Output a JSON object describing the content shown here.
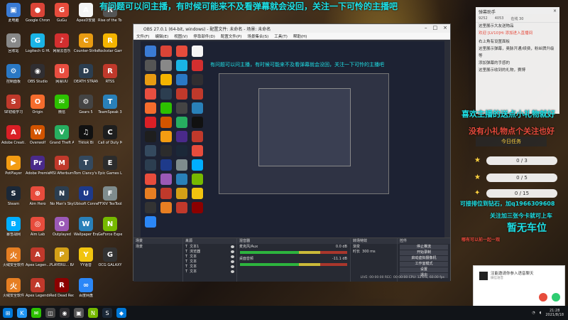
{
  "banner": {
    "text": "有问题可以问主播，有时候可能来不及看弹幕就会没回，关注一下可怜的主播吧"
  },
  "desktop_icons": [
    {
      "label": "此电脑",
      "color": "#3a7bd5",
      "glyph": "▣",
      "icon": "computer-icon"
    },
    {
      "label": "Google Chrome",
      "color": "#db4437",
      "glyph": "●",
      "icon": "chrome-icon"
    },
    {
      "label": "GuGu",
      "color": "#e74c3c",
      "glyph": "G",
      "icon": "app-icon"
    },
    {
      "label": "ApexD安装",
      "color": "#f5f5f5",
      "glyph": "A",
      "icon": "file-icon"
    },
    {
      "label": "Rise of the Tomb Ra...",
      "color": "#555",
      "glyph": "R",
      "icon": "game-icon"
    },
    {
      "label": "回收站",
      "color": "#888",
      "glyph": "♻",
      "icon": "recycle-bin-icon"
    },
    {
      "label": "Logitech G HUB",
      "color": "#1ab4e6",
      "glyph": "G",
      "icon": "logitech-icon"
    },
    {
      "label": "网易云音乐",
      "color": "#d32f2f",
      "glyph": "♪",
      "icon": "music-icon"
    },
    {
      "label": "Counter-Strike Global Off...",
      "color": "#e89b12",
      "glyph": "C",
      "icon": "csgo-icon"
    },
    {
      "label": "Rockstar Games",
      "color": "#f4b400",
      "glyph": "R",
      "icon": "rockstar-icon"
    },
    {
      "label": "控制面板",
      "color": "#2a78c4",
      "glyph": "⚙",
      "icon": "control-panel-icon"
    },
    {
      "label": "OBS Studio",
      "color": "#302e31",
      "glyph": "◉",
      "icon": "obs-icon"
    },
    {
      "label": "网易UU",
      "color": "#e84e40",
      "glyph": "U",
      "icon": "uu-icon"
    },
    {
      "label": "DEATH STRANDING",
      "color": "#2c3e50",
      "glyph": "D",
      "icon": "game-icon"
    },
    {
      "label": "RTSS",
      "color": "#c0392b",
      "glyph": "R",
      "icon": "rtss-icon"
    },
    {
      "label": "SE初级学习",
      "color": "#c0392b",
      "glyph": "S",
      "icon": "app-icon"
    },
    {
      "label": "Origin",
      "color": "#f56c2d",
      "glyph": "O",
      "icon": "origin-icon"
    },
    {
      "label": "微信",
      "color": "#2dc100",
      "glyph": "✉",
      "icon": "wechat-icon"
    },
    {
      "label": "Gears 5",
      "color": "#444",
      "glyph": "⚙",
      "icon": "game-icon"
    },
    {
      "label": "TeamSpeak 3",
      "color": "#2980b9",
      "glyph": "T",
      "icon": "teamspeak-icon"
    },
    {
      "label": "Adobe Creati...",
      "color": "#da1f26",
      "glyph": "A",
      "icon": "adobe-icon"
    },
    {
      "label": "Overwolf",
      "color": "#d35400",
      "glyph": "W",
      "icon": "overwolf-icon"
    },
    {
      "label": "Grand Theft Auto V",
      "color": "#27ae60",
      "glyph": "V",
      "icon": "gta-icon"
    },
    {
      "label": "Tiktok Bi",
      "color": "#111",
      "glyph": "♫",
      "icon": "app-icon"
    },
    {
      "label": "Call of Duty Modern...",
      "color": "#1e1e1e",
      "glyph": "C",
      "icon": "game-icon"
    },
    {
      "label": "PotPlayer",
      "color": "#f39c12",
      "glyph": "▶",
      "icon": "potplayer-icon"
    },
    {
      "label": "Adobe Premie...",
      "color": "#4a2a8a",
      "glyph": "Pr",
      "icon": "premiere-icon"
    },
    {
      "label": "MSI Afterburner",
      "color": "#c0392b",
      "glyph": "M",
      "icon": "msi-icon"
    },
    {
      "label": "Tom Clancy's R...",
      "color": "#34495e",
      "glyph": "T",
      "icon": "game-icon"
    },
    {
      "label": "Epic Games Launcher",
      "color": "#2c2c2c",
      "glyph": "E",
      "icon": "epic-icon"
    },
    {
      "label": "Steam",
      "color": "#1b2838",
      "glyph": "S",
      "icon": "steam-icon"
    },
    {
      "label": "Aim Hero",
      "color": "#e74c3c",
      "glyph": "⊕",
      "icon": "aim-icon"
    },
    {
      "label": "No Man's Sky",
      "color": "#2c3e50",
      "glyph": "N",
      "icon": "game-icon"
    },
    {
      "label": "Ubisoft Connect",
      "color": "#1e3a8a",
      "glyph": "U",
      "icon": "ubisoft-icon"
    },
    {
      "label": "FFXIV TexTools",
      "color": "#7f8c8d",
      "glyph": "F",
      "icon": "app-icon"
    },
    {
      "label": "暴雪战网",
      "color": "#00aeff",
      "glyph": "B",
      "icon": "battlenet-icon"
    },
    {
      "label": "Aim Lab",
      "color": "#e74c3c",
      "glyph": "◎",
      "icon": "aimlab-icon"
    },
    {
      "label": "Outplayed",
      "color": "#9b59b6",
      "glyph": "O",
      "icon": "outplayed-icon"
    },
    {
      "label": "Wallpaper Engine",
      "color": "#2980b9",
      "glyph": "W",
      "icon": "wallpaper-icon"
    },
    {
      "label": "GeForce Experience",
      "color": "#76b900",
      "glyph": "N",
      "icon": "nvidia-icon"
    },
    {
      "label": "火绒安全软件",
      "color": "#e67e22",
      "glyph": "火",
      "icon": "security-icon"
    },
    {
      "label": "Apex Legen...",
      "color": "#c0392b",
      "glyph": "A",
      "icon": "apex-icon"
    },
    {
      "label": "PLAYERU... BATTLEGR...",
      "color": "#d4a017",
      "glyph": "P",
      "icon": "pubg-icon"
    },
    {
      "label": "YY语音",
      "color": "#f1c40f",
      "glyph": "Y",
      "icon": "yy-icon"
    },
    {
      "label": "OCG GALAXY",
      "color": "#333",
      "glyph": "G",
      "icon": "app-icon"
    },
    {
      "label": "火绒安全软件",
      "color": "#e67e22",
      "glyph": "火",
      "icon": "security-icon"
    },
    {
      "label": "Apex Legends",
      "color": "#c0392b",
      "glyph": "A",
      "icon": "apex-icon"
    },
    {
      "label": "Red Dead Redempti...",
      "color": "#8b0000",
      "glyph": "R",
      "icon": "rdr-icon"
    },
    {
      "label": "百度网盘",
      "color": "#2b87f7",
      "glyph": "∞",
      "icon": "baidu-pan-icon"
    }
  ],
  "obs": {
    "title": "OBS 27.0.1 (64-bit, windows) - 配置文件: 未命名 - 场景: 未命名",
    "menu": [
      "文件(F)",
      "编辑(E)",
      "视图(V)",
      "停靠部件(D)",
      "配置文件(P)",
      "场景集合(S)",
      "工具(T)",
      "帮助(H)"
    ],
    "preview_text": "有问题可以问主播，有时候可能来不及看弹幕就会没回，关注一下可怜的主播吧",
    "docks": {
      "scenes": {
        "title": "场景",
        "items": [
          "场景"
        ]
      },
      "sources": {
        "title": "来源",
        "items": [
          "文本1",
          "浏览器",
          "文本",
          "文本",
          "文本",
          "文本"
        ]
      },
      "mixer": {
        "title": "混音器",
        "channels": [
          {
            "name": "麦克风/Aux",
            "level": "0.0 dB"
          },
          {
            "name": "桌面音频",
            "level": "-11.1 dB"
          }
        ]
      },
      "transitions": {
        "title": "转场特效",
        "type": "渐变",
        "duration_label": "时长",
        "duration": "300 ms"
      },
      "controls": {
        "title": "控件",
        "buttons": [
          "停止推流",
          "开始录制",
          "启动虚拟摄像机",
          "工作室模式",
          "设置",
          "退出"
        ]
      }
    },
    "status": "LIVE: 00:00:00  REC: 00:00:00  CPU: 12.0%, 60.00 fps"
  },
  "chat": {
    "title": "弹幕助手",
    "stats": [
      "9252",
      "4053",
      "在线 30"
    ],
    "lines": [
      {
        "text": "这里展示大友送物品",
        "hl": false
      },
      {
        "text": "欢迎 [LV10]Hi 添加进入直播间",
        "hl": true
      },
      {
        "text": "",
        "hl": false
      },
      {
        "text": "右上角有设置面板",
        "hl": false
      },
      {
        "text": "这里展示弹幕，奥脉开通/续费，粉丝牌升级",
        "hl": false
      },
      {
        "text": "等",
        "hl": false
      },
      {
        "text": "添加弹幕的手感的",
        "hl": false
      },
      {
        "text": "这里展示收到的礼物，赛博",
        "hl": false
      }
    ]
  },
  "overlay": {
    "gift_line": "喜欢主播的送点小礼物就好",
    "follow_line": "没有小礼物点个关注也好",
    "task_head": "今日任务",
    "tasks": [
      "0 / 3",
      "0 / 5",
      "0 / 15"
    ],
    "queue_line": "可接排位到钻石，加q1966309608",
    "follow_car": "关注加三张今卡就可上车",
    "no_car": "暂无车位",
    "small_hint": "哪有可以前一起一观"
  },
  "notification": {
    "title": "注能邀请你参入语音聊天",
    "sub": "微信语音"
  },
  "taskbar": {
    "apps": [
      {
        "icon": "windows-start-icon",
        "glyph": "⊞",
        "color": "#0078d7"
      },
      {
        "icon": "app-k-icon",
        "glyph": "K",
        "color": "#2196f3"
      },
      {
        "icon": "wechat-icon",
        "glyph": "✉",
        "color": "#2dc100"
      },
      {
        "icon": "app-icon",
        "glyph": "◫",
        "color": "#444"
      },
      {
        "icon": "obs-icon",
        "glyph": "◉",
        "color": "#302e31"
      },
      {
        "icon": "app-icon",
        "glyph": "▣",
        "color": "#555"
      },
      {
        "icon": "nvidia-icon",
        "glyph": "N",
        "color": "#76b900"
      },
      {
        "icon": "steam-icon",
        "glyph": "S",
        "color": "#1b2838"
      },
      {
        "icon": "browser-icon",
        "glyph": "◆",
        "color": "#0078d7"
      }
    ],
    "time": "21:28",
    "date": "2021/8/18"
  },
  "colors": {
    "banner": "#1fe0e6",
    "accent": "#ffd23f",
    "red": "#e64a3c"
  }
}
